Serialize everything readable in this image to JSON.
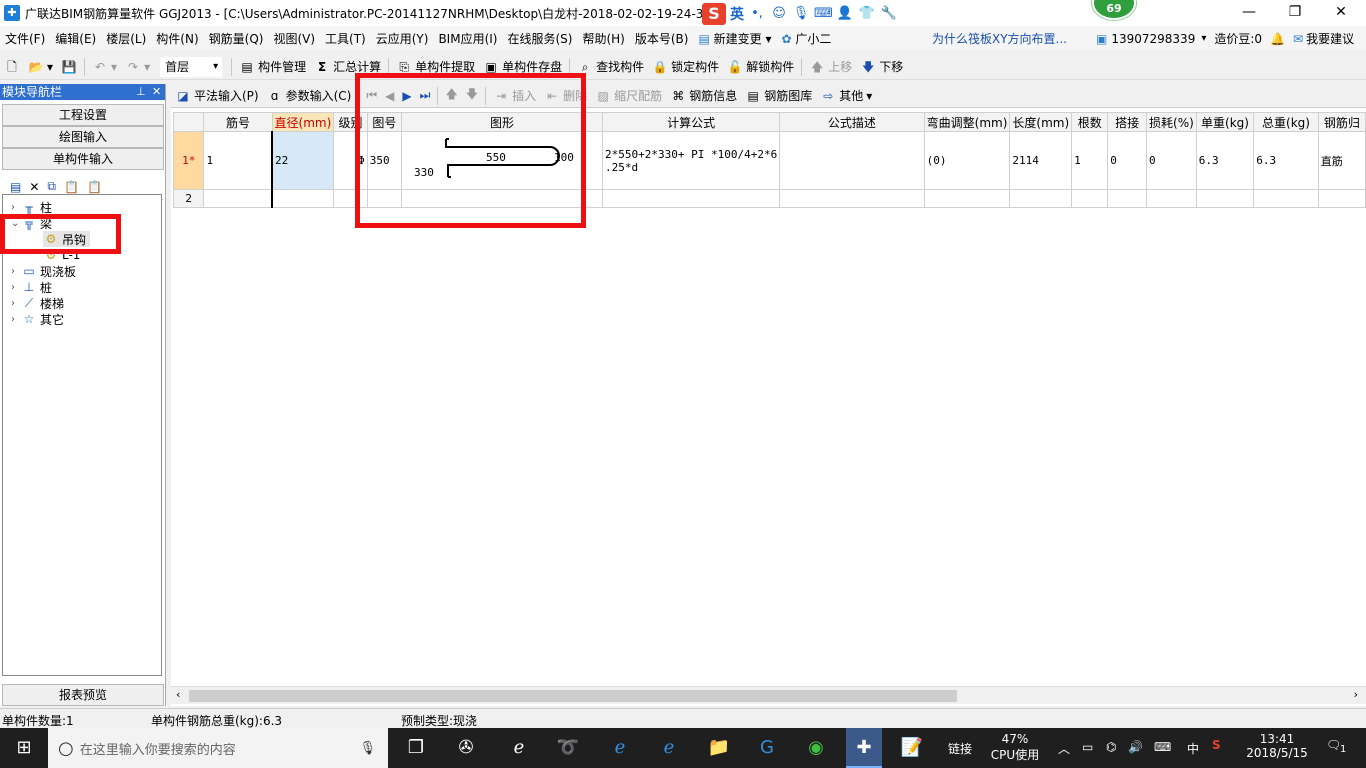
{
  "window": {
    "title": "广联达BIM钢筋算量软件 GGJ2013 - [C:\\Users\\Administrator.PC-20141127NRHM\\Desktop\\白龙村-2018-02-02-19-24-35",
    "badge": "69",
    "ime_lang": "英"
  },
  "menu": {
    "items": [
      "文件(F)",
      "编辑(E)",
      "楼层(L)",
      "构件(N)",
      "钢筋量(Q)",
      "视图(V)",
      "工具(T)",
      "云应用(Y)",
      "BIM应用(I)",
      "在线服务(S)",
      "帮助(H)",
      "版本号(B)"
    ],
    "new_change": "新建变更",
    "assistant": "广小二",
    "ad_text": "为什么筏板XY方向布置...",
    "phone": "13907298339",
    "price_beans": "造价豆:0",
    "feedback": "我要建议"
  },
  "toolbar": {
    "floor": "首层",
    "component_mgmt": "构件管理",
    "summary_calc": "汇总计算",
    "single_extract": "单构件提取",
    "single_save": "单构件存盘",
    "find_component": "查找构件",
    "lock_component": "锁定构件",
    "unlock_component": "解锁构件",
    "move_up": "上移",
    "move_down": "下移"
  },
  "subtoolbar": {
    "flat_input": "平法输入(P)",
    "param_input": "参数输入(C)",
    "insert": "插入",
    "delete": "删除",
    "scale_config": "缩尺配筋",
    "rebar_info": "钢筋信息",
    "rebar_library": "钢筋图库",
    "other": "其他"
  },
  "leftnav": {
    "header": "模块导航栏",
    "buttons": [
      "工程设置",
      "绘图输入",
      "单构件输入"
    ],
    "tree": [
      {
        "label": "柱",
        "icon": "column-icon"
      },
      {
        "label": "梁",
        "icon": "beam-icon"
      },
      {
        "label": "吊钩",
        "icon": "hook-icon"
      },
      {
        "label": "L-1",
        "icon": "component-icon"
      },
      {
        "label": "现浇板",
        "icon": "slab-icon"
      },
      {
        "label": "桩",
        "icon": "pile-icon"
      },
      {
        "label": "楼梯",
        "icon": "stair-icon"
      },
      {
        "label": "其它",
        "icon": "star-icon"
      }
    ],
    "report_preview": "报表预览"
  },
  "grid": {
    "headers": [
      "筋号",
      "直径(mm)",
      "级别",
      "图号",
      "图形",
      "计算公式",
      "公式描述",
      "弯曲调整(mm)",
      "长度(mm)",
      "根数",
      "搭接",
      "损耗(%)",
      "单重(kg)",
      "总重(kg)",
      "钢筋归"
    ],
    "rows": [
      {
        "rownum": "1*",
        "bar_no": "1",
        "diameter": "22",
        "grade": "Φ",
        "shape_no": "350",
        "shape_main": "550",
        "shape_hook": "100",
        "shape_leg": "330",
        "formula_line1": "2*550+2*330+ PI *100/4+2*6",
        "formula_line2": ".25*d",
        "formula_desc": "",
        "bend_adjust": "(0)",
        "length": "2114",
        "count": "1",
        "lap": "0",
        "loss": "0",
        "unit_weight": "6.3",
        "total_weight": "6.3",
        "category": "直筋"
      }
    ],
    "empty_row": "2"
  },
  "status": {
    "count": "单构件数量:1",
    "weight": "单构件钢筋总重(kg):6.3",
    "precast": "预制类型:现浇"
  },
  "taskbar": {
    "search_placeholder": "在这里输入你要搜索的内容",
    "link": "链接",
    "cpu_percent": "47%",
    "cpu_label": "CPU使用",
    "ime": "中",
    "time": "13:41",
    "date": "2018/5/15",
    "notification_count": "1"
  },
  "colors": {
    "highlight_red": "#ee1010",
    "nav_header": "#2f6fd0"
  }
}
